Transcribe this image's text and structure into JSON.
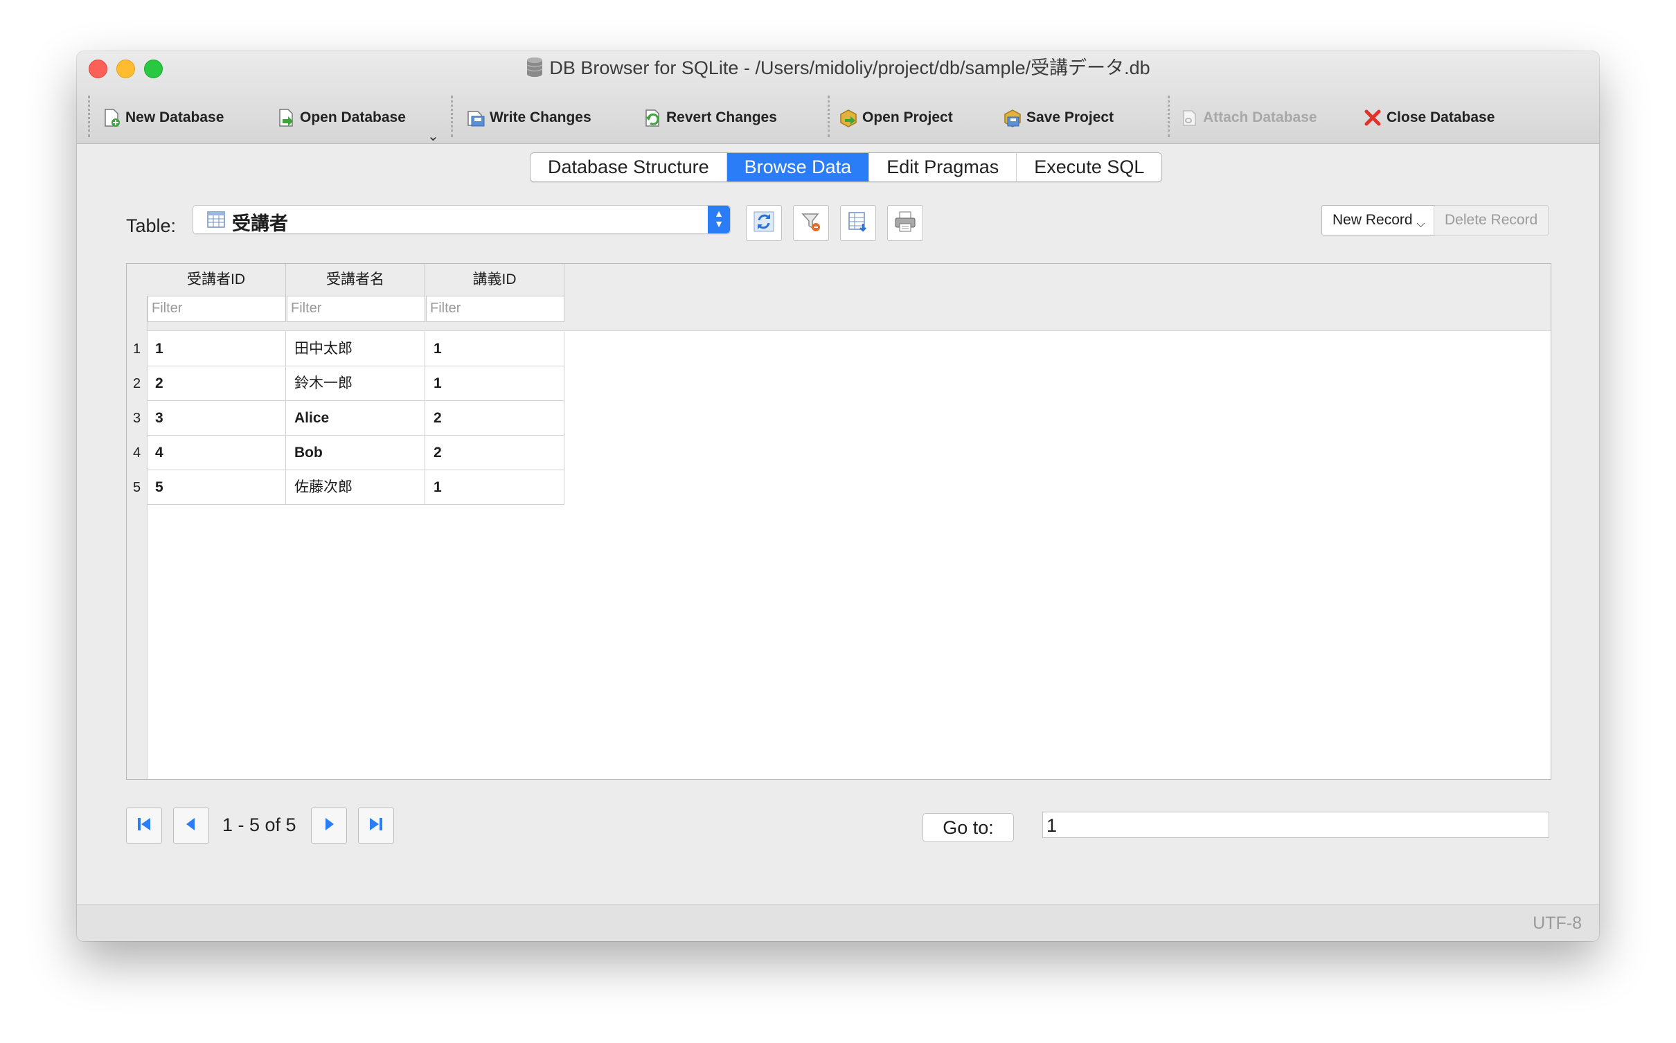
{
  "window": {
    "title": "DB Browser for SQLite - /Users/midoliy/project/db/sample/受講データ.db"
  },
  "toolbar": {
    "new_database": "New Database",
    "open_database": "Open Database",
    "write_changes": "Write Changes",
    "revert_changes": "Revert Changes",
    "open_project": "Open Project",
    "save_project": "Save Project",
    "attach_database": "Attach Database",
    "close_database": "Close Database"
  },
  "tabs": [
    {
      "label": "Database Structure",
      "active": false
    },
    {
      "label": "Browse Data",
      "active": true
    },
    {
      "label": "Edit Pragmas",
      "active": false
    },
    {
      "label": "Execute SQL",
      "active": false
    }
  ],
  "browse": {
    "table_label": "Table:",
    "selected_table": "受講者",
    "new_record": "New Record",
    "delete_record": "Delete Record",
    "filter_placeholder": "Filter",
    "columns": [
      "受講者ID",
      "受講者名",
      "講義ID"
    ],
    "rows": [
      {
        "num": "1",
        "cells": [
          "1",
          "田中太郎",
          "1"
        ]
      },
      {
        "num": "2",
        "cells": [
          "2",
          "鈴木一郎",
          "1"
        ]
      },
      {
        "num": "3",
        "cells": [
          "3",
          "Alice",
          "2"
        ]
      },
      {
        "num": "4",
        "cells": [
          "4",
          "Bob",
          "2"
        ]
      },
      {
        "num": "5",
        "cells": [
          "5",
          "佐藤次郎",
          "1"
        ]
      }
    ]
  },
  "pager": {
    "range_text": "1 - 5 of 5",
    "goto_label": "Go to:",
    "goto_value": "1"
  },
  "status": {
    "encoding": "UTF-8"
  },
  "colors": {
    "accent": "#2a7cf7",
    "close_red": "#fe5f57",
    "minimize_yellow": "#febc2e",
    "maximize_green": "#28c840"
  }
}
